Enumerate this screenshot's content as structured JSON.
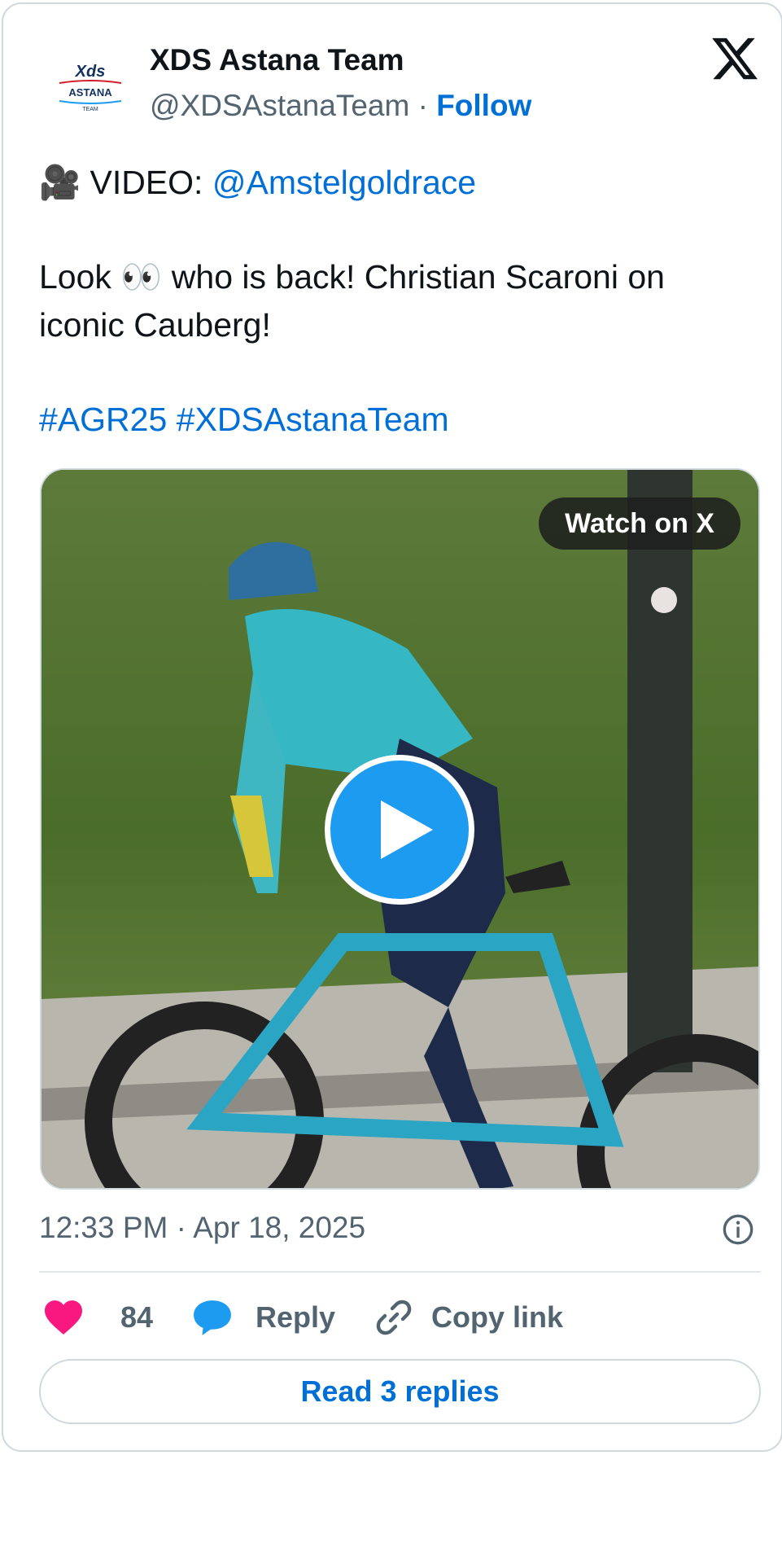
{
  "author": {
    "name": "XDS Astana Team",
    "handle": "@XDSAstanaTeam",
    "separator": "·",
    "follow_label": "Follow",
    "avatar_text": {
      "line1": "Xds",
      "line2": "ASTANA",
      "line3": "TEAM"
    }
  },
  "tweet": {
    "video_icon": "🎥",
    "video_prefix": "VIDEO:",
    "video_mention": "@Amstelgoldrace",
    "body_start": "Look",
    "eyes_icon": "👀",
    "body_end": "who is back! Christian Scaroni on iconic Cauberg!",
    "hashtag1": "#AGR25",
    "hashtag2": "#XDSAstanaTeam"
  },
  "media": {
    "watch_label": "Watch on X"
  },
  "meta": {
    "timestamp": "12:33 PM · Apr 18, 2025"
  },
  "actions": {
    "like_count": "84",
    "reply_label": "Reply",
    "copy_label": "Copy link"
  },
  "read_replies_label": "Read 3 replies",
  "colors": {
    "link": "#006fd6",
    "like_heart": "#f91880",
    "reply_bubble": "#1d9bf0",
    "play_button": "#1d9bf0"
  },
  "icons": [
    "x-logo-icon",
    "video-camera-icon",
    "eyes-icon",
    "play-icon",
    "info-icon",
    "heart-icon",
    "reply-bubble-icon",
    "link-icon"
  ]
}
